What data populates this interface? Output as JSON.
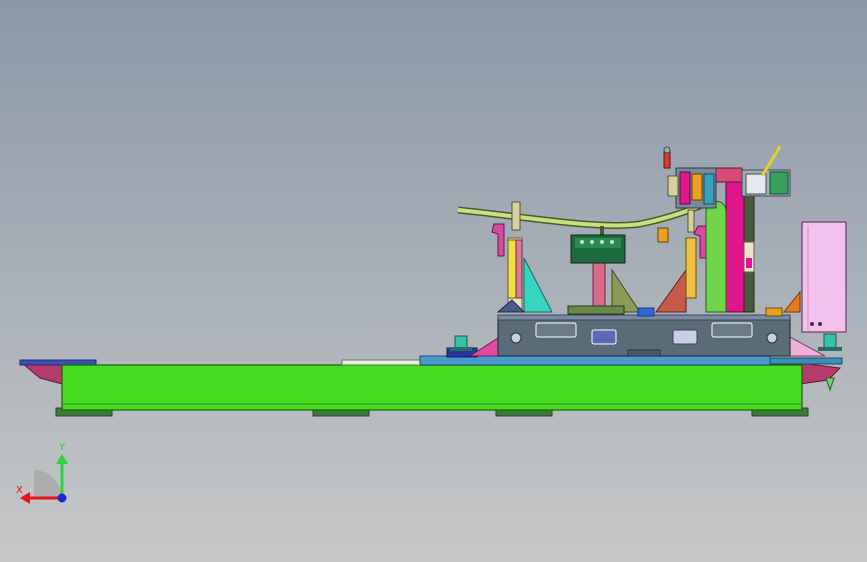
{
  "viewport": {
    "background_top": "#8b98a9",
    "background_bottom": "#c7c8c8"
  },
  "triad": {
    "x_label": "X",
    "y_label": "Y",
    "x_color": "#e8141e",
    "y_color": "#2ad63a",
    "z_color": "#1a2ad8"
  },
  "colors": {
    "base_rail": "#44dd1f",
    "support_plate": "#5a6c78",
    "magenta_part": "#e0148c",
    "pink_cabinet": "#f3c2ec",
    "teal_gusset": "#38d6c0",
    "orange_part": "#e87a1e",
    "olive_gusset": "#8a9c56"
  }
}
